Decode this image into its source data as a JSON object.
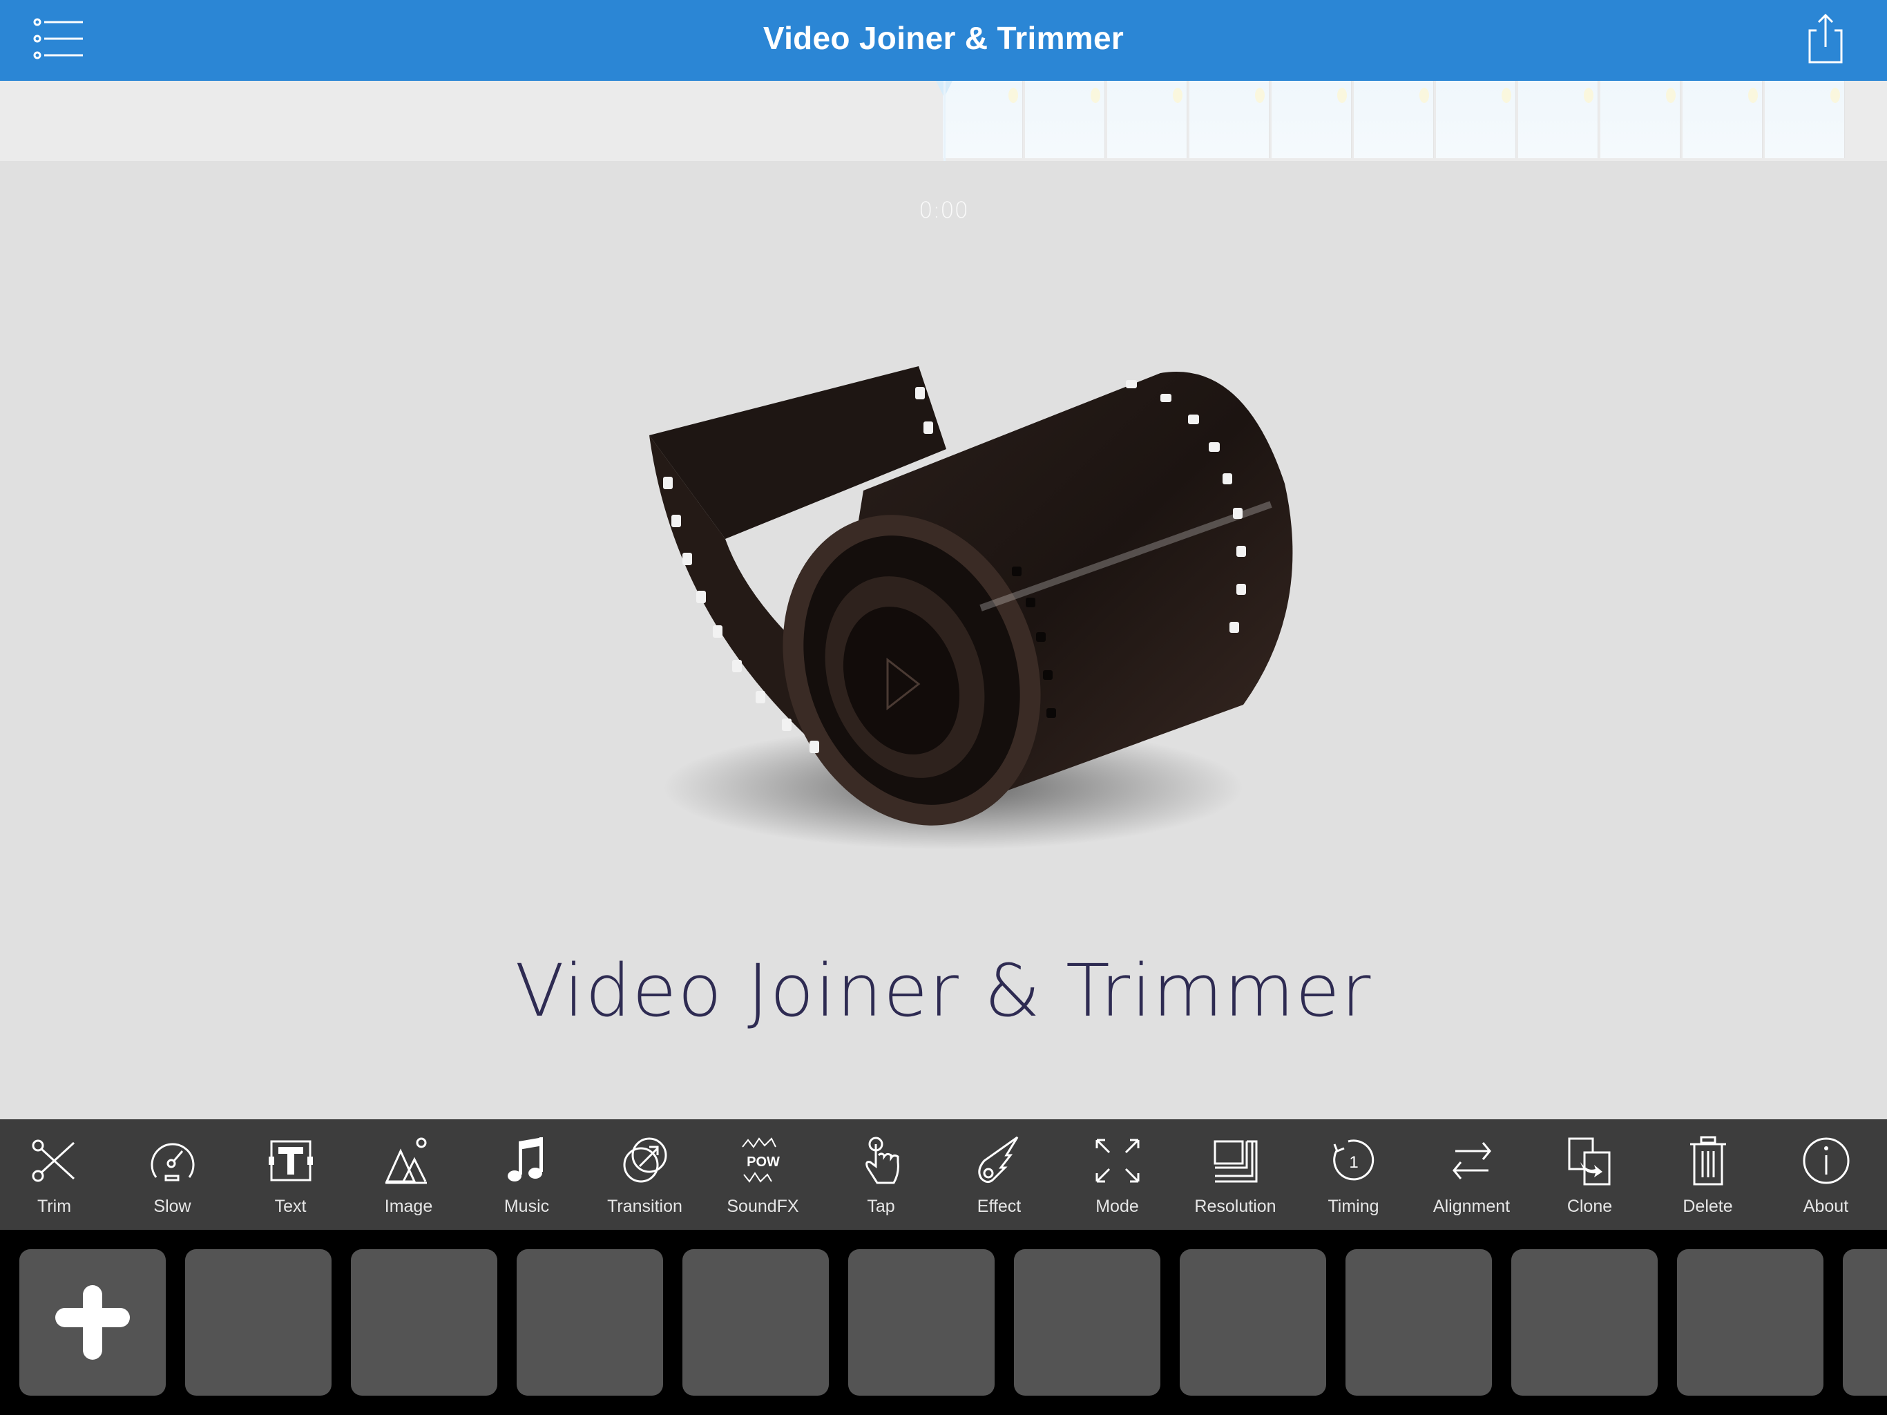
{
  "header": {
    "title": "Video Joiner & Trimmer",
    "menu_icon": "list-menu-icon",
    "share_icon": "share-icon",
    "color": "#2B86D5"
  },
  "timeline": {
    "frame_count": 11,
    "playhead_icon": "playhead-marker-icon"
  },
  "preview": {
    "current_time": "0:00",
    "artwork": "film-reel-icon",
    "brand_text": "Video Joiner & Trimmer"
  },
  "toolbar": {
    "items": [
      {
        "label": "Trim",
        "icon": "scissors-icon"
      },
      {
        "label": "Slow",
        "icon": "speedometer-icon"
      },
      {
        "label": "Text",
        "icon": "text-box-icon"
      },
      {
        "label": "Image",
        "icon": "mountain-image-icon"
      },
      {
        "label": "Music",
        "icon": "music-note-icon"
      },
      {
        "label": "Transition",
        "icon": "transition-circles-icon"
      },
      {
        "label": "SoundFX",
        "icon": "pow-burst-icon"
      },
      {
        "label": "Tap",
        "icon": "tap-hand-icon"
      },
      {
        "label": "Effect",
        "icon": "comet-icon"
      },
      {
        "label": "Mode",
        "icon": "expand-arrows-icon"
      },
      {
        "label": "Resolution",
        "icon": "resolution-frames-icon"
      },
      {
        "label": "Timing",
        "icon": "timer-icon"
      },
      {
        "label": "Alignment",
        "icon": "swap-arrows-icon"
      },
      {
        "label": "Clone",
        "icon": "clone-icon"
      },
      {
        "label": "Delete",
        "icon": "trash-icon"
      },
      {
        "label": "About",
        "icon": "info-icon"
      }
    ]
  },
  "tray": {
    "add_icon": "plus-icon",
    "empty_slots": 11
  }
}
